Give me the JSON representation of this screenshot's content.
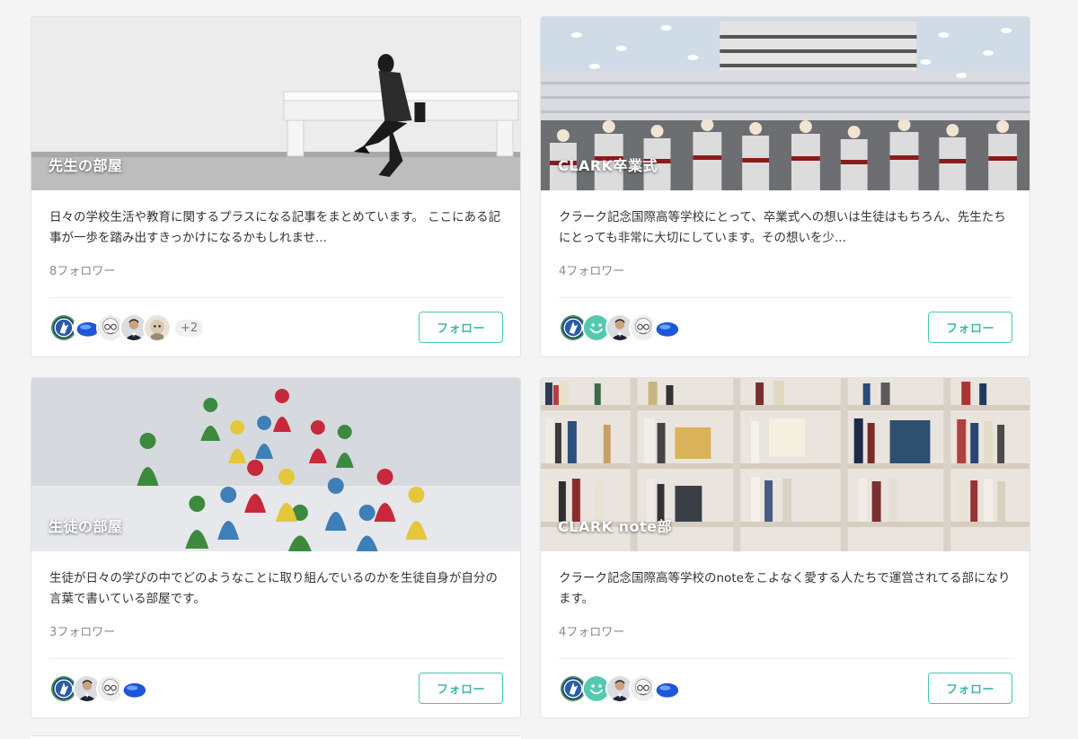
{
  "cards": [
    {
      "title": "先生の部屋",
      "description": "日々の学校生活や教育に関するプラスになる記事をまとめています。 ここにある記事が一歩を踏み出すきっかけになるかもしれませ...",
      "followers": "8フォロワー",
      "avatars": [
        "emblem-avatar",
        "blue-blob-avatar",
        "glasses-sketch-avatar",
        "man-suit-avatar",
        "cartoon-avatar"
      ],
      "more": "+2",
      "follow_label": "フォロー",
      "image": "woman-on-bench-image"
    },
    {
      "title": "CLARK卒業式",
      "description": "クラーク記念国際高等学校にとって、卒業式への想いは生徒はもちろん、先生たちにとっても非常に大切にしています。その想いを少...",
      "followers": "4フォロワー",
      "avatars": [
        "emblem-avatar",
        "smile-avatar",
        "man-suit-avatar",
        "glasses-sketch-avatar",
        "blue-blob-avatar"
      ],
      "follow_label": "フォロー",
      "image": "graduation-ceremony-image"
    },
    {
      "title": "生徒の部屋",
      "description": "生徒が日々の学びの中でどのようなことに取り組んでいるのかを生徒自身が自分の言葉で書いている部屋です。",
      "followers": "3フォロワー",
      "avatars": [
        "emblem-avatar",
        "man-suit-avatar",
        "glasses-sketch-avatar",
        "blue-blob-avatar"
      ],
      "follow_label": "フォロー",
      "image": "game-pieces-image"
    },
    {
      "title": "CLARK note部",
      "description": "クラーク記念国際高等学校のnoteをこよなく愛する人たちで運営されてる部になります。",
      "followers": "4フォロワー",
      "avatars": [
        "emblem-avatar",
        "smile-avatar",
        "man-suit-avatar",
        "glasses-sketch-avatar",
        "blue-blob-avatar"
      ],
      "follow_label": "フォロー",
      "image": "bookshelf-image"
    }
  ],
  "colors": {
    "accent": "#41c9b4",
    "background": "#f4f4f4",
    "card": "#ffffff"
  }
}
